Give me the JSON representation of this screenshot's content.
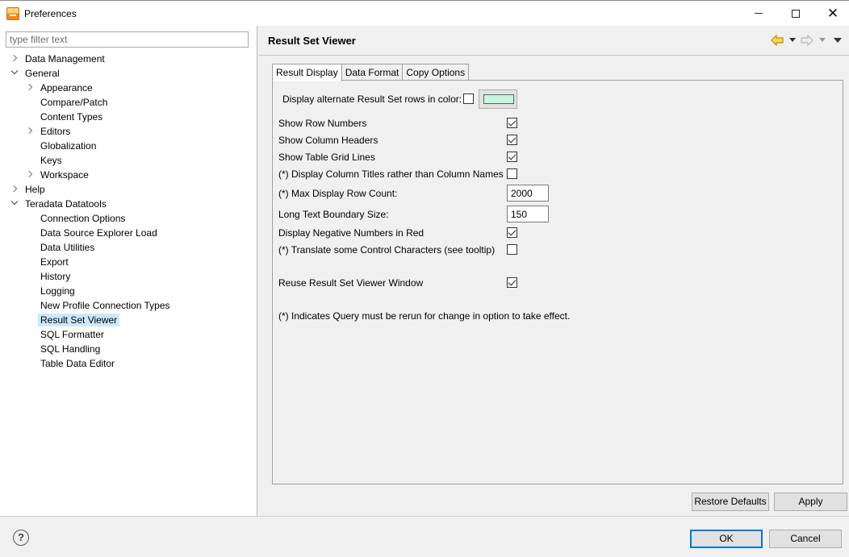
{
  "window": {
    "title": "Preferences",
    "minimize_icon": "minimize-icon",
    "maximize_icon": "maximize-icon",
    "close_icon": "close-icon",
    "close_glyph": "✕"
  },
  "filter": {
    "placeholder": "type filter text",
    "value": ""
  },
  "tree": [
    {
      "label": "Data Management",
      "twisty": "collapsed"
    },
    {
      "label": "General",
      "twisty": "expanded"
    },
    {
      "label": "Appearance",
      "twisty": "collapsed"
    },
    {
      "label": "Compare/Patch",
      "twisty": ""
    },
    {
      "label": "Content Types",
      "twisty": ""
    },
    {
      "label": "Editors",
      "twisty": "collapsed"
    },
    {
      "label": "Globalization",
      "twisty": ""
    },
    {
      "label": "Keys",
      "twisty": ""
    },
    {
      "label": "Workspace",
      "twisty": "collapsed"
    },
    {
      "label": "Help",
      "twisty": "collapsed"
    },
    {
      "label": "Teradata Datatools",
      "twisty": "expanded"
    },
    {
      "label": "Connection Options",
      "twisty": ""
    },
    {
      "label": "Data Source Explorer Load",
      "twisty": ""
    },
    {
      "label": "Data Utilities",
      "twisty": ""
    },
    {
      "label": "Export",
      "twisty": ""
    },
    {
      "label": "History",
      "twisty": ""
    },
    {
      "label": "Logging",
      "twisty": ""
    },
    {
      "label": "New Profile Connection Types",
      "twisty": ""
    },
    {
      "label": "Result Set Viewer",
      "twisty": "",
      "selected": true
    },
    {
      "label": "SQL Formatter",
      "twisty": ""
    },
    {
      "label": "SQL Handling",
      "twisty": ""
    },
    {
      "label": "Table Data Editor",
      "twisty": ""
    }
  ],
  "page": {
    "title": "Result Set Viewer",
    "tabs": [
      "Result Display",
      "Data Format",
      "Copy Options"
    ],
    "active_tab": 0,
    "alternate_rows": {
      "label": "Display alternate Result Set rows in color:",
      "checked": false,
      "color": "#c6f7e2"
    },
    "options": [
      {
        "label": "Show Row Numbers",
        "checked": true
      },
      {
        "label": "Show Column Headers",
        "checked": true
      },
      {
        "label": "Show Table Grid Lines",
        "checked": true
      },
      {
        "label": "(*) Display Column Titles rather than Column Names",
        "checked": false
      }
    ],
    "max_rows": {
      "label": "(*) Max Display Row Count:",
      "value": "2000"
    },
    "long_text": {
      "label": "Long Text Boundary Size:",
      "value": "150"
    },
    "options2": [
      {
        "label": "Display Negative Numbers in Red",
        "checked": true
      },
      {
        "label": "(*) Translate some Control Characters (see tooltip)",
        "checked": false
      }
    ],
    "reuse": {
      "label": "Reuse Result Set Viewer Window",
      "checked": true
    },
    "note": "(*) Indicates Query must be rerun for change in option to take effect.",
    "restore_defaults": "Restore Defaults",
    "apply": "Apply"
  },
  "buttons": {
    "ok": "OK",
    "cancel": "Cancel",
    "help": "?"
  },
  "colors": {
    "selection": "#cce8ff",
    "default_button_border": "#0078d7",
    "nav_arrow": "#e8a000"
  }
}
